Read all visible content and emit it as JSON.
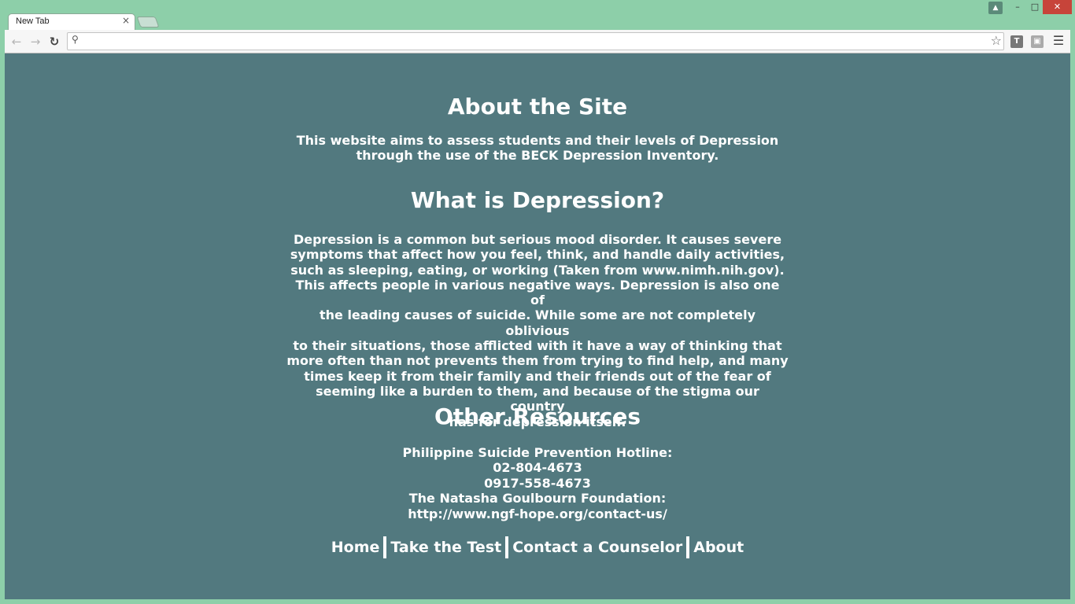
{
  "browser": {
    "tab_title": "New Tab",
    "tab_close": "×",
    "omnibox_value": "",
    "ext_t_label": "T",
    "window_controls": {
      "minimize": "–",
      "maximize": "□",
      "close": "✕"
    }
  },
  "page": {
    "background_color": "#52797f",
    "about": {
      "title": "About the Site",
      "text_lines": [
        "This website aims to assess students and their levels of Depression",
        "through the use of the BECK Depression Inventory."
      ]
    },
    "depression": {
      "title": "What is Depression?",
      "text_lines": [
        "Depression is a common but serious mood disorder. It causes severe",
        "symptoms that affect how you feel, think, and handle daily activities,",
        "such as sleeping, eating, or working (Taken from www.nimh.nih.gov).",
        "This affects people in various negative ways. Depression is also one of",
        "the leading causes of suicide. While some are not completely oblivious",
        "to their situations, those afflicted with it have a way of thinking that",
        "more often than not prevents them from trying to find help, and many",
        "times keep it from their family and their friends out of the fear of",
        "seeming like a burden to them, and because of the stigma our country",
        "has for depression itself."
      ]
    },
    "resources": {
      "title": "Other Resources",
      "lines": [
        "Philippine Suicide Prevention Hotline:",
        "02-804-4673",
        "0917-558-4673",
        "The Natasha Goulbourn Foundation:",
        "http://www.ngf-hope.org/contact-us/"
      ]
    },
    "nav": {
      "home": "Home",
      "take_test": "Take the Test",
      "contact": "Contact a Counselor",
      "about": "About"
    }
  }
}
